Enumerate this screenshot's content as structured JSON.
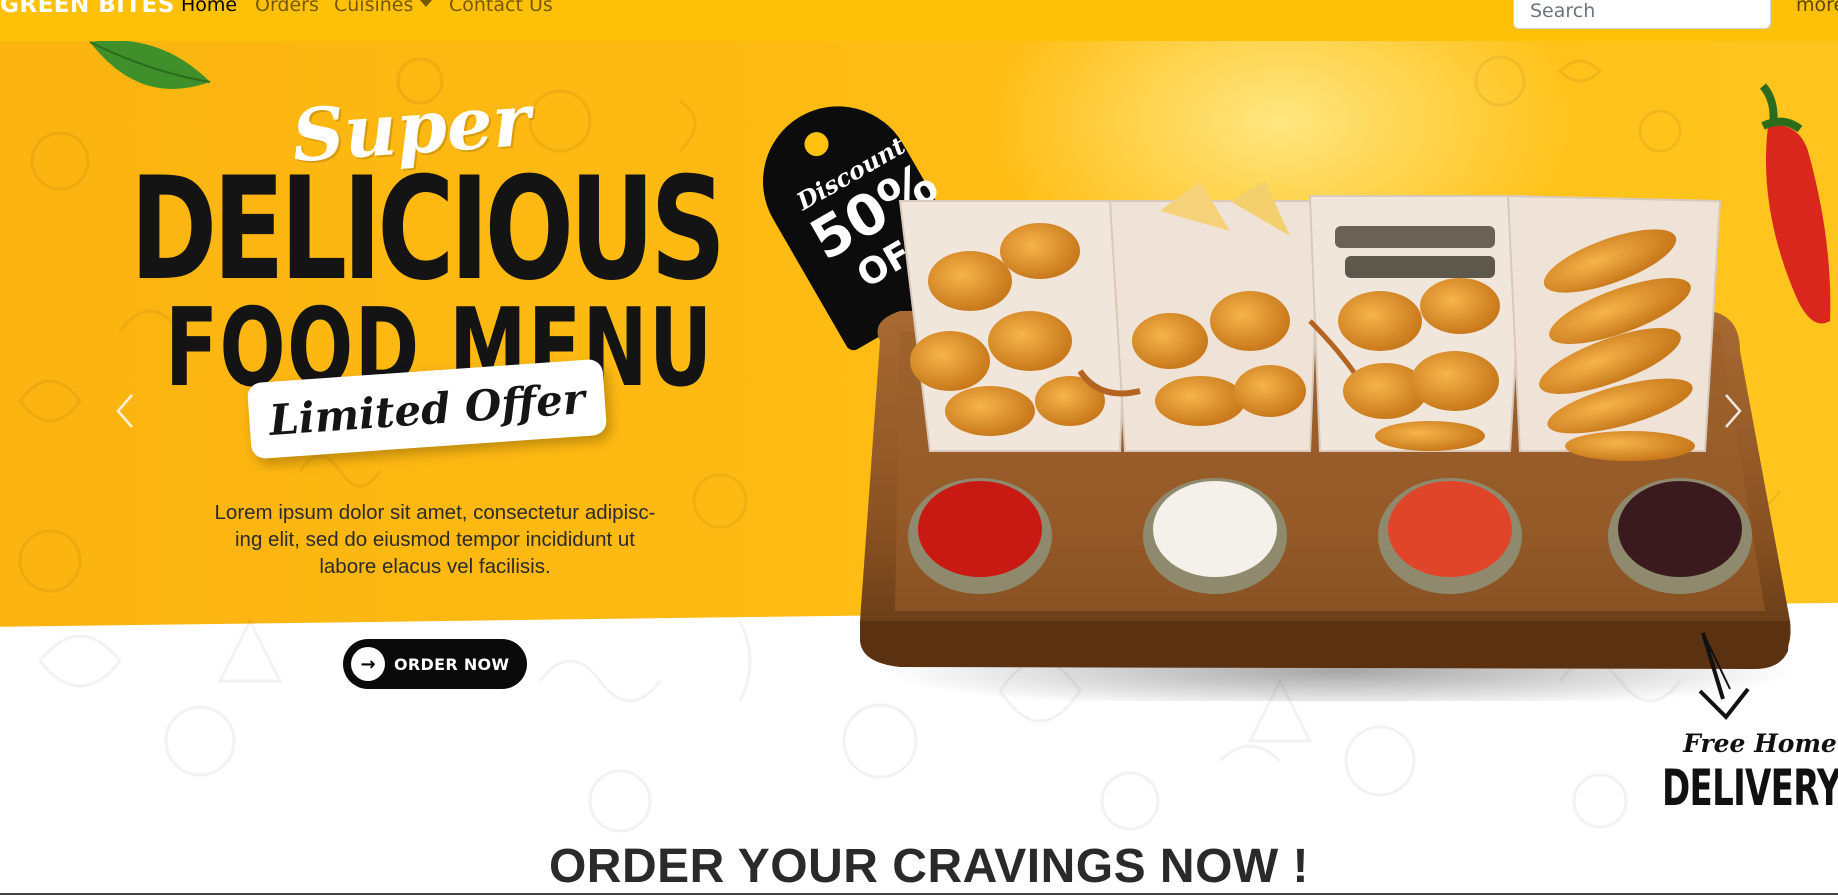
{
  "navbar": {
    "brand": "GREEN BITES",
    "links": [
      {
        "label": "Home",
        "active": true
      },
      {
        "label": "Orders",
        "active": false
      },
      {
        "label": "Cuisines",
        "active": false,
        "dropdown": true
      },
      {
        "label": "Contact Us",
        "active": false
      }
    ],
    "search_placeholder": "Search",
    "more_label": "more"
  },
  "hero": {
    "super": "Super",
    "delicious": "DELICIOUS",
    "food_menu": "FOOD MENU",
    "limited_offer": "Limited Offer",
    "copy_lines": [
      "Lorem ipsum dolor sit amet, consectetur adipisc-",
      "ing elit, sed do eiusmod tempor incididunt ut",
      "labore elacus vel facilisis."
    ],
    "order_button": "ORDER NOW",
    "tag": {
      "discount": "Discount",
      "percent": "50%",
      "off": "OFF"
    },
    "free_home": "Free Home",
    "delivery": "DELIVERY"
  },
  "section": {
    "heading": "ORDER YOUR CRAVINGS NOW !"
  },
  "colors": {
    "navbar_bg": "#ffc107",
    "hero_yellow": "#fcb410",
    "text_dark": "#141414"
  },
  "icons": {
    "prev": "chevron-left-icon",
    "next": "chevron-right-icon",
    "order": "arrow-right-icon",
    "caret": "caret-down-icon"
  }
}
